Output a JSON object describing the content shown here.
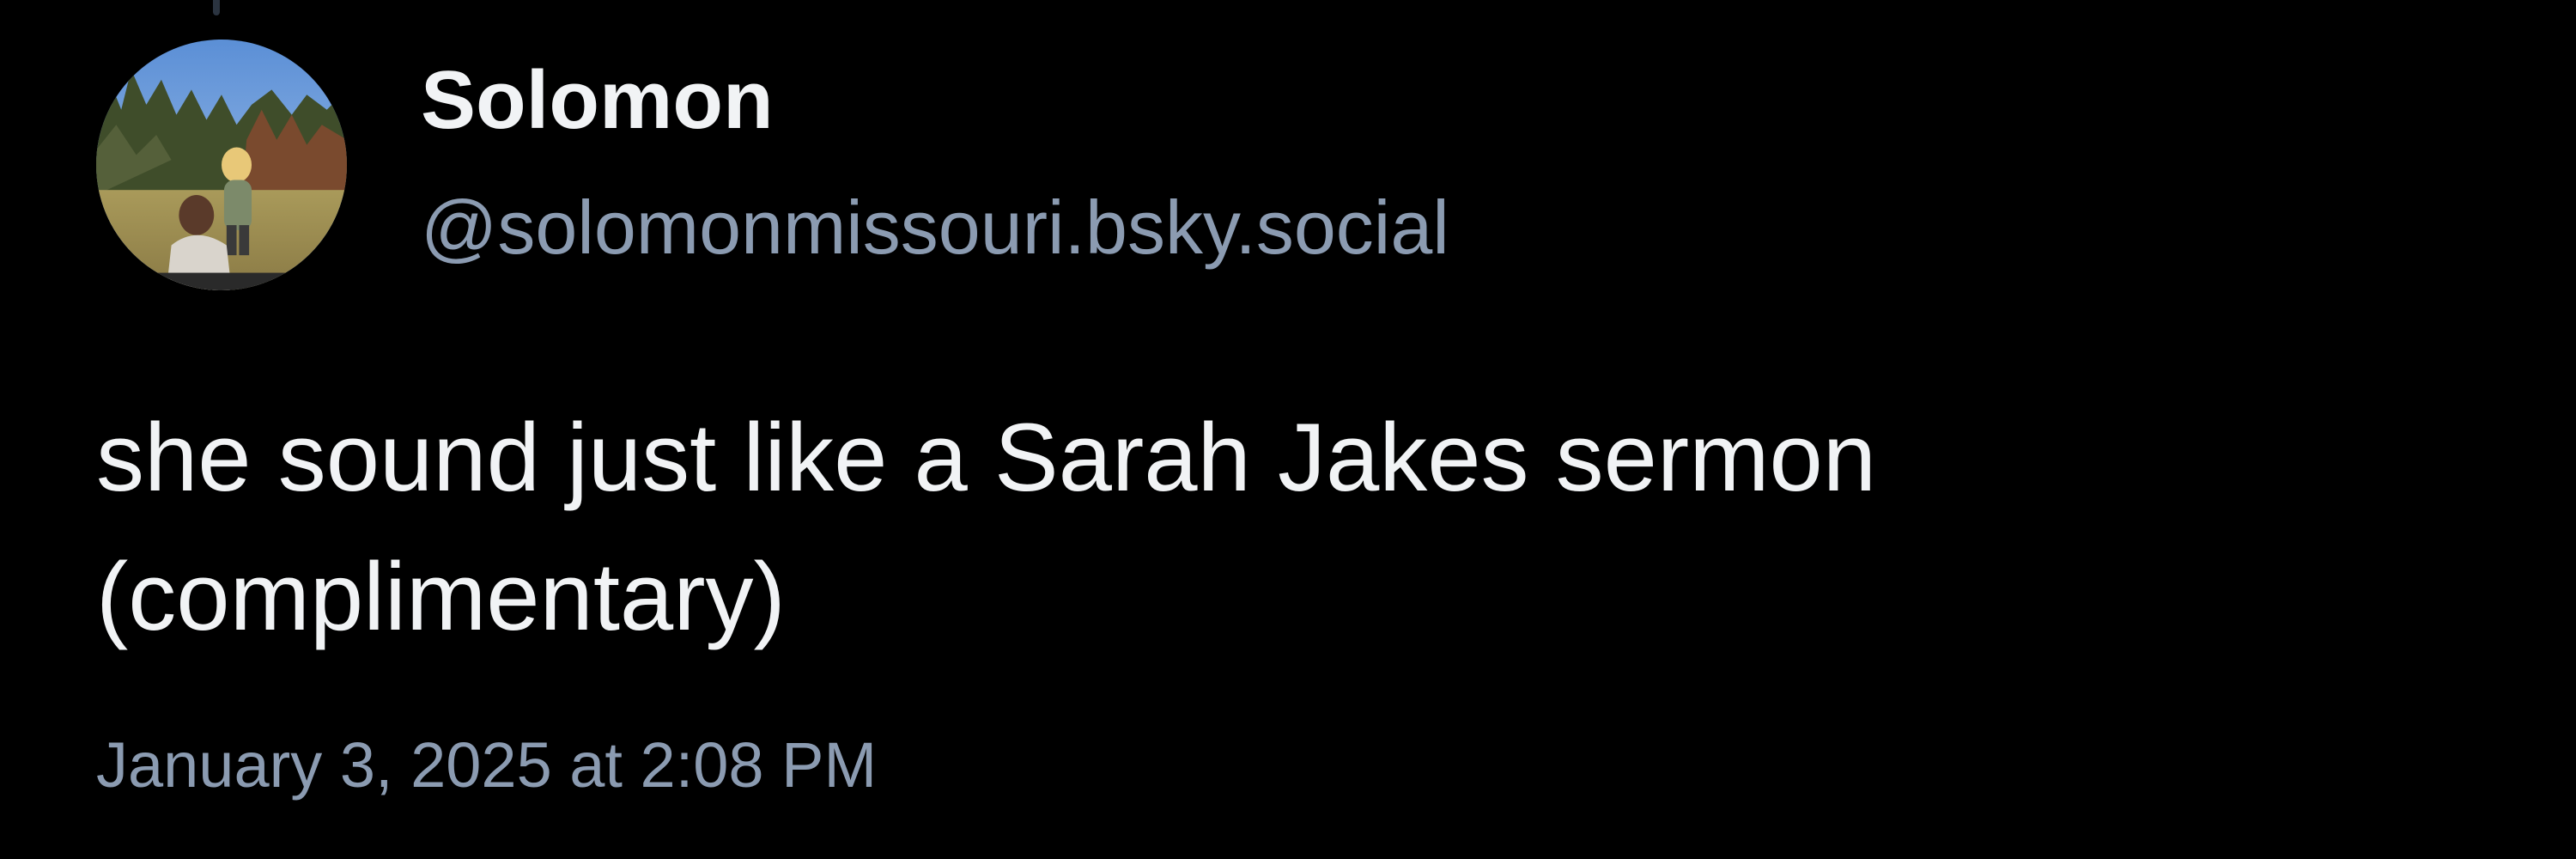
{
  "post": {
    "author": {
      "display_name": "Solomon",
      "handle": "@solomonmissouri.bsky.social",
      "avatar": "profile-photo"
    },
    "text": "she sound just like a Sarah Jakes sermon\n(complimentary)",
    "timestamp": "January 3, 2025 at 2:08 PM"
  },
  "colors": {
    "background": "#000000",
    "primary_text": "#f1f3f5",
    "secondary_text": "#8b9bb1",
    "thread_line": "#2b3440"
  }
}
